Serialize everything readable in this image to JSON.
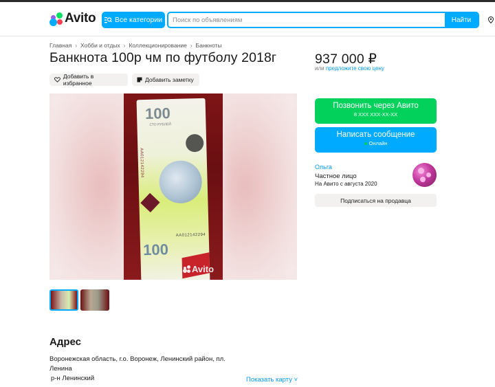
{
  "header": {
    "logo_text": "Avito",
    "categories_label": "Все категории",
    "search_placeholder": "Поиск по объявлениям",
    "search_button": "Найти"
  },
  "breadcrumb": [
    "Главная",
    "Хобби и отдых",
    "Коллекционирование",
    "Банкноты"
  ],
  "listing": {
    "title": "Банкнота 100р чм по футболу 2018г",
    "favorite_label": "Добавить в избранное",
    "note_label": "Добавить заметку",
    "image_watermark": "Avito",
    "banknote_value": "100",
    "banknote_text": "СТО РУБЛЕЙ",
    "banknote_serial": "АА012142294"
  },
  "price": {
    "amount": "937 000 ₽",
    "offer_prefix": "или",
    "offer_link": "предложите свою цену"
  },
  "actions": {
    "call_label": "Позвонить через Авито",
    "call_phone": "8 XXX XXX-XX-XX",
    "message_label": "Написать сообщение",
    "online_label": "Онлайн"
  },
  "seller": {
    "name": "Ольга",
    "type": "Частное лицо",
    "since": "На Авито с августа 2020",
    "subscribe_label": "Подписаться на продавца"
  },
  "address": {
    "heading": "Адрес",
    "text": "Воронежская область, г.о. Воронеж, Ленинский район, пл. Ленина",
    "district": "р-н Ленинский",
    "show_map": "Показать карту"
  },
  "colors": {
    "accent_blue": "#00aaff",
    "call_green": "#02d15c",
    "link_blue": "#0099f7"
  }
}
